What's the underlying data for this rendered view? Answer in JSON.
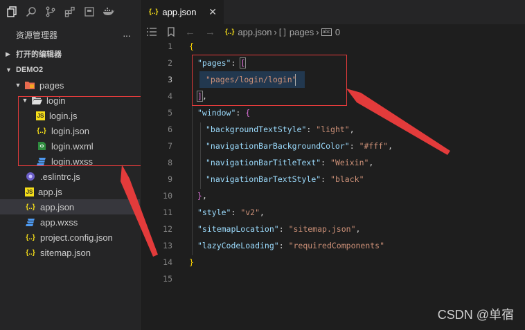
{
  "sidebar": {
    "title": "资源管理器",
    "more": "···",
    "section_open_editors": "打开的编辑器",
    "section_project": "DEMO2",
    "tree": [
      {
        "label": "pages",
        "icon": "folder-pages-icon"
      },
      {
        "label": "login",
        "icon": "folder-open-icon"
      },
      {
        "label": "login.js",
        "icon": "js-file-icon"
      },
      {
        "label": "login.json",
        "icon": "json-file-icon"
      },
      {
        "label": "login.wxml",
        "icon": "wxml-file-icon"
      },
      {
        "label": "login.wxss",
        "icon": "css-file-icon"
      },
      {
        "label": ".eslintrc.js",
        "icon": "eslint-file-icon"
      },
      {
        "label": "app.js",
        "icon": "js-file-icon"
      },
      {
        "label": "app.json",
        "icon": "json-file-icon",
        "selected": true
      },
      {
        "label": "app.wxss",
        "icon": "css-file-icon"
      },
      {
        "label": "project.config.json",
        "icon": "json-file-icon"
      },
      {
        "label": "sitemap.json",
        "icon": "json-file-icon"
      }
    ]
  },
  "tab": {
    "icon_text": "{..}",
    "label": "app.json",
    "close": "✕"
  },
  "breadcrumb": {
    "file_icon": "{..}",
    "file": "app.json",
    "arr": "[ ]",
    "pages": "pages",
    "index_icon": "abc",
    "index": "0"
  },
  "icons": {
    "json": "{..}",
    "js": "JS"
  },
  "editor": {
    "line_numbers": [
      "1",
      "2",
      "3",
      "4",
      "5",
      "6",
      "7",
      "8",
      "9",
      "10",
      "11",
      "12",
      "13",
      "14",
      "15"
    ],
    "current_line": 3,
    "code": {
      "l1_open": "{",
      "l2_key": "\"pages\"",
      "l2_colon": ": ",
      "l2_bracket": "[",
      "l3_value": "\"pages/login/login\"",
      "l4_bracket": "]",
      "l4_comma": ",",
      "l5_key": "\"window\"",
      "l5_colon": ": ",
      "l5_brace": "{",
      "l6_key": "\"backgroundTextStyle\"",
      "l6_value": "\"light\"",
      "l7_key": "\"navigationBarBackgroundColor\"",
      "l7_value": "\"#fff\"",
      "l8_key": "\"navigationBarTitleText\"",
      "l8_value": "\"Weixin\"",
      "l9_key": "\"navigationBarTextStyle\"",
      "l9_value": "\"black\"",
      "l10_close": "}",
      "l10_comma": ",",
      "l11_key": "\"style\"",
      "l11_value": "\"v2\"",
      "l12_key": "\"sitemapLocation\"",
      "l12_value": "\"sitemap.json\"",
      "l13_key": "\"lazyCodeLoading\"",
      "l13_value": "\"requiredComponents\"",
      "l14_close": "}",
      "colon": ": ",
      "comma": ","
    }
  },
  "watermark": "CSDN @单宿",
  "colors": {
    "annotation": "#e33b3b",
    "key": "#9cdcfe",
    "string": "#ce9178"
  }
}
